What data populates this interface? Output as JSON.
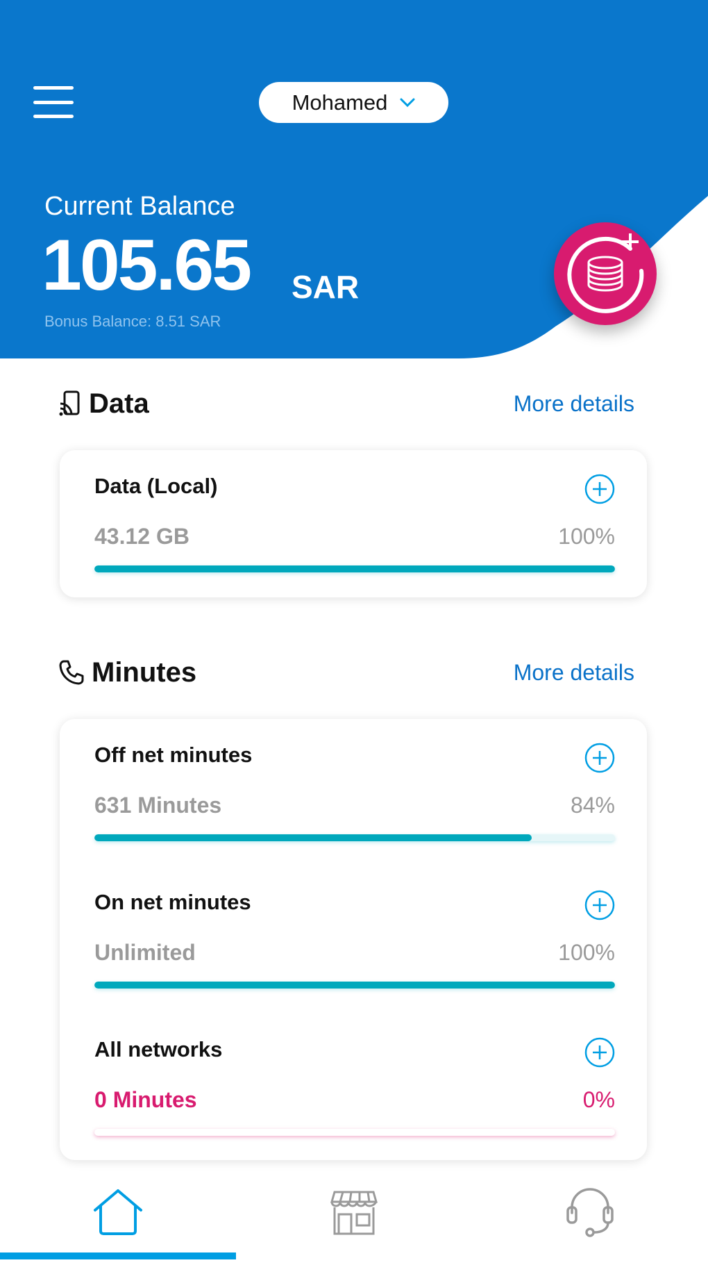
{
  "colors": {
    "primary": "#0a77cc",
    "accent": "#d81b6f",
    "progress": "#00a8bc",
    "link": "#0a72c9"
  },
  "header": {
    "menu_icon": "hamburger-icon",
    "user_name": "Mohamed",
    "user_dropdown_icon": "chevron-down-icon"
  },
  "balance": {
    "label": "Current Balance",
    "amount": "105.65",
    "currency": "SAR",
    "bonus": "Bonus Balance: 8.51 SAR",
    "recharge_icon": "coins-plus-icon"
  },
  "data_section": {
    "icon": "phone-signal-icon",
    "title": "Data",
    "more": "More details",
    "items": [
      {
        "name": "Data (Local)",
        "value": "43.12 GB",
        "percent": "100%",
        "fill": 1.0
      }
    ]
  },
  "minutes_section": {
    "icon": "phone-icon",
    "title": "Minutes",
    "more": "More details",
    "items": [
      {
        "name": "Off net minutes",
        "value": "631 Minutes",
        "percent": "84%",
        "fill": 0.84
      },
      {
        "name": "On net minutes",
        "value": "Unlimited",
        "percent": "100%",
        "fill": 1.0
      },
      {
        "name": "All networks",
        "value": "0 Minutes",
        "percent": "0%",
        "fill": 0.0
      }
    ]
  },
  "bottom_nav": [
    {
      "icon": "home-icon",
      "active": true
    },
    {
      "icon": "store-icon",
      "active": false
    },
    {
      "icon": "headset-support-icon",
      "active": false
    }
  ]
}
